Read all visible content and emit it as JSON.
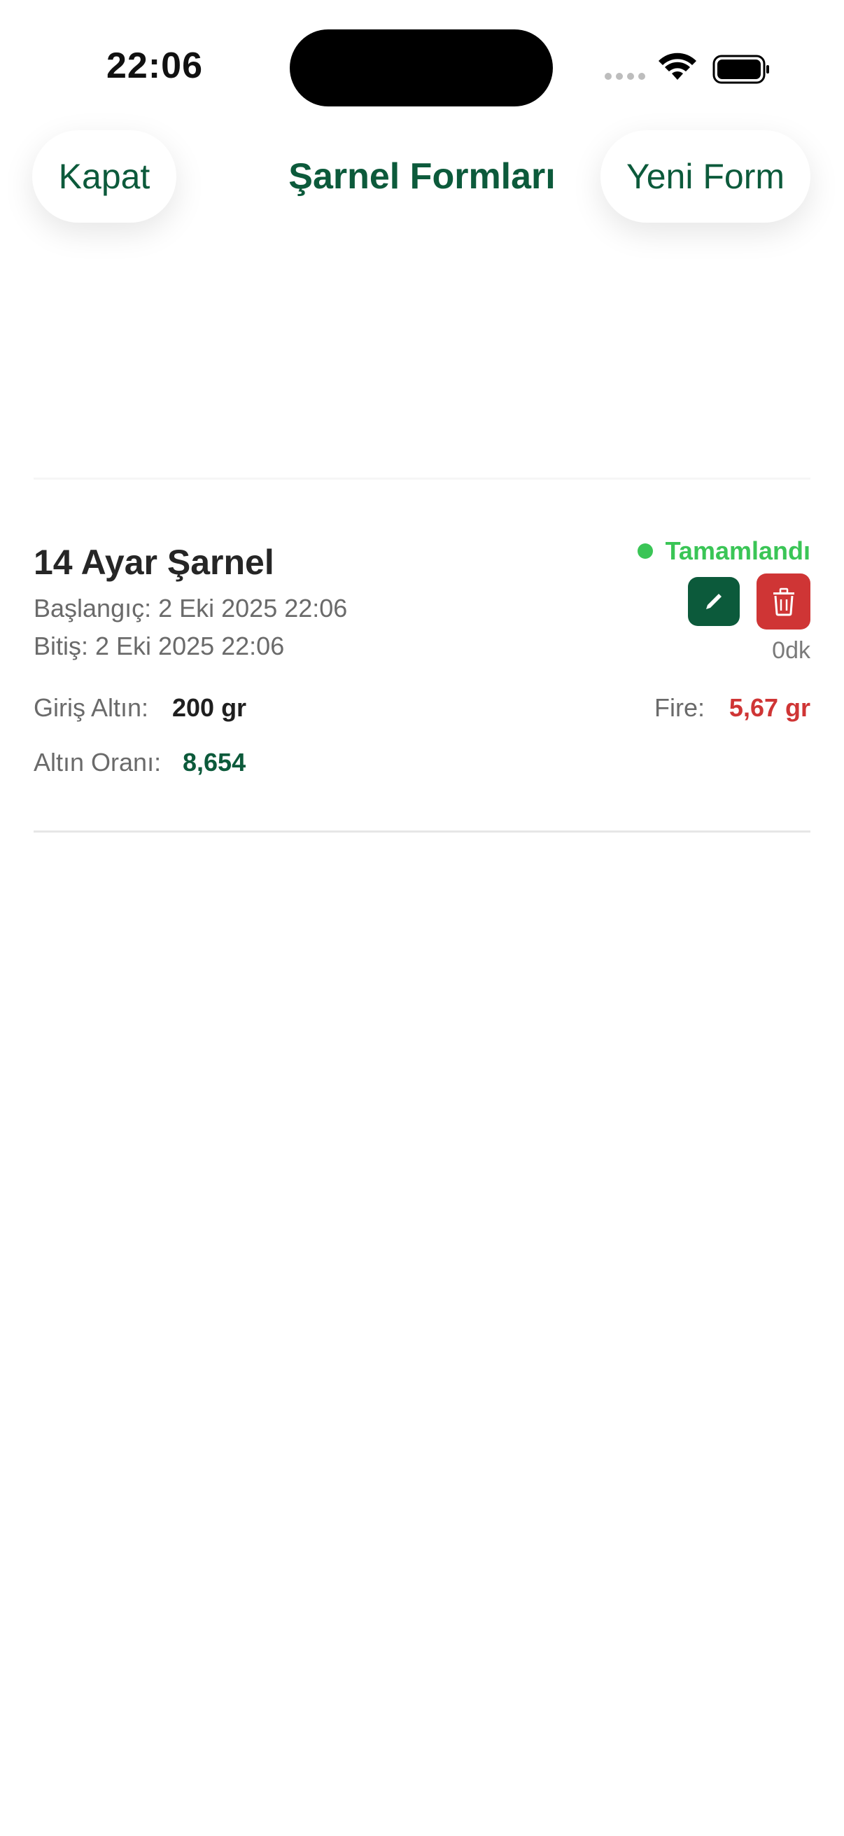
{
  "status_bar": {
    "time": "22:06"
  },
  "nav": {
    "close_label": "Kapat",
    "title": "Şarnel Formları",
    "new_label": "Yeni Form"
  },
  "form": {
    "title": "14 Ayar Şarnel",
    "start": "Başlangıç: 2 Eki 2025 22:06",
    "end": "Bitiş: 2 Eki 2025 22:06",
    "status": "Tamamlandı",
    "duration": "0dk",
    "input_gold_label": "Giriş Altın:",
    "input_gold_value": "200 gr",
    "loss_label": "Fire:",
    "loss_value": "5,67 gr",
    "ratio_label": "Altın Oranı:",
    "ratio_value": "8,654",
    "edit_icon": "pencil-icon",
    "delete_icon": "trash-icon"
  },
  "colors": {
    "accent": "#0c5a3b",
    "success": "#3ac556",
    "danger": "#cf3535"
  }
}
